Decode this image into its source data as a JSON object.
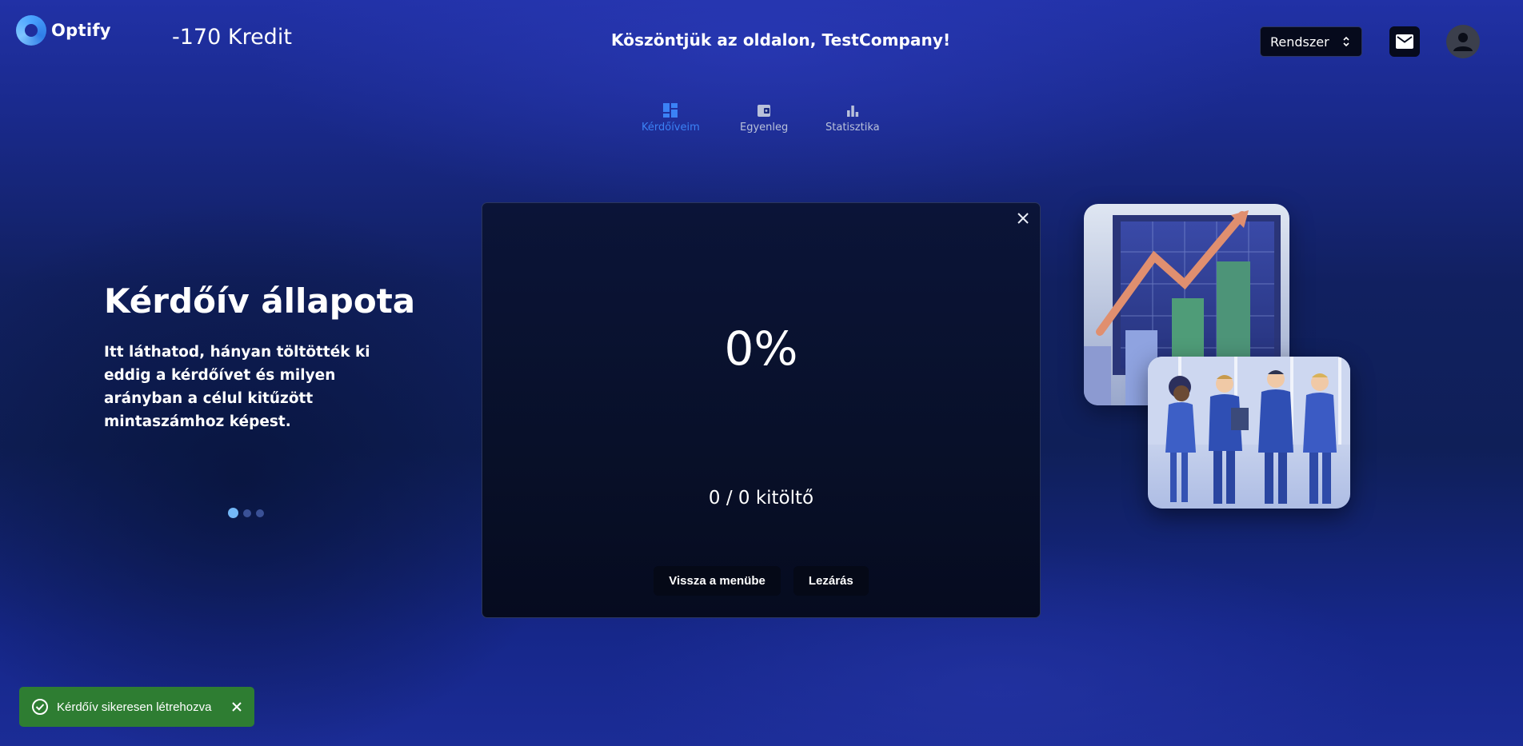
{
  "header": {
    "logo_text": "Optify",
    "credit": "-170 Kredit",
    "welcome": "Köszöntjük az oldalon, TestCompany!",
    "system_select": "Rendszer"
  },
  "nav": {
    "items": [
      {
        "label": "Kérdőíveim",
        "icon": "dashboard-icon",
        "active": true
      },
      {
        "label": "Egyenleg",
        "icon": "wallet-icon",
        "active": false
      },
      {
        "label": "Statisztika",
        "icon": "bar-chart-icon",
        "active": false
      }
    ]
  },
  "intro": {
    "title": "Kérdőív állapota",
    "description": "Itt láthatod, hányan töltötték ki eddig a kérdőívet és milyen arányban a célul kitűzött mintaszámhoz képest.",
    "carousel_pages": 3,
    "carousel_active": 1
  },
  "status_card": {
    "percent": "0%",
    "respondents": "0 / 0 kitöltő",
    "back_button": "Vissza a menübe",
    "close_button": "Lezárás"
  },
  "toast": {
    "message": "Kérdőív sikeresen létrehozva"
  },
  "colors": {
    "accent": "#3b82f6",
    "toast_bg": "#2e7d32",
    "card_bg": "#0a1232"
  }
}
